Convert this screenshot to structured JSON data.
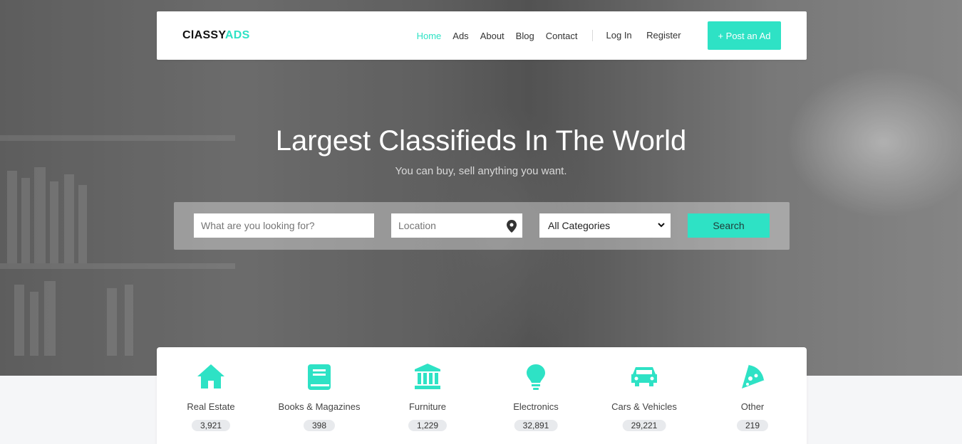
{
  "brand": {
    "logo_main": "ClASSY",
    "logo_accent": "ADS"
  },
  "nav": {
    "links": [
      {
        "label": "Home",
        "active": true
      },
      {
        "label": "Ads"
      },
      {
        "label": "About"
      },
      {
        "label": "Blog"
      },
      {
        "label": "Contact"
      }
    ],
    "login": "Log In",
    "register": "Register",
    "post_ad": "+ Post an Ad"
  },
  "hero": {
    "title": "Largest Classifieds In The World",
    "subtitle": "You can buy, sell anything you want."
  },
  "search": {
    "query_placeholder": "What are you looking for?",
    "location_placeholder": "Location",
    "category_selected": "All Categories",
    "button": "Search"
  },
  "categories": [
    {
      "label": "Real Estate",
      "count": "3,921",
      "icon": "home-icon"
    },
    {
      "label": "Books & Magazines",
      "count": "398",
      "icon": "book-icon"
    },
    {
      "label": "Furniture",
      "count": "1,229",
      "icon": "building-columns-icon"
    },
    {
      "label": "Electronics",
      "count": "32,891",
      "icon": "lightbulb-icon"
    },
    {
      "label": "Cars & Vehicles",
      "count": "29,221",
      "icon": "car-icon"
    },
    {
      "label": "Other",
      "count": "219",
      "icon": "pizza-icon"
    }
  ],
  "colors": {
    "accent": "#2ee2c5",
    "navbar_bg": "#ffffff",
    "page_bg": "#f5f6f8"
  }
}
